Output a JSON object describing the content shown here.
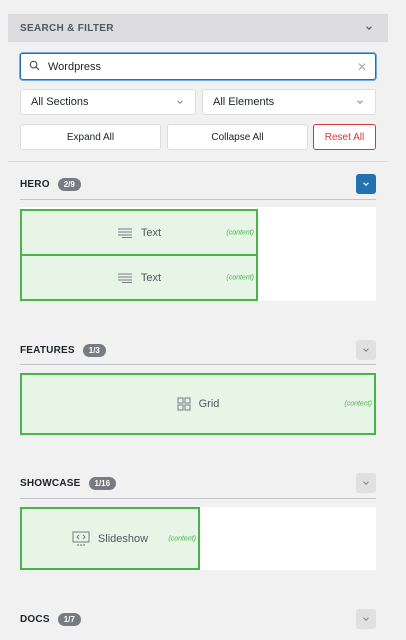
{
  "panel": {
    "title": "SEARCH & FILTER"
  },
  "search": {
    "value": "Wordpress",
    "clear_symbol": "✕"
  },
  "filters": {
    "sections_label": "All Sections",
    "elements_label": "All Elements"
  },
  "buttons": {
    "expand": "Expand All",
    "collapse": "Collapse All",
    "reset": "Reset All"
  },
  "colors": {
    "accent": "#2271b1",
    "match_border": "#4ab34a",
    "match_fill": "#e7f5e6",
    "reset": "#d63638"
  },
  "sections": [
    {
      "title": "HERO",
      "badge": "2/9",
      "expanded": true,
      "elements": [
        {
          "label": "Text",
          "icon": "text-icon",
          "tag": "(content)"
        },
        {
          "label": "Text",
          "icon": "text-icon",
          "tag": "(content)"
        }
      ]
    },
    {
      "title": "FEATURES",
      "badge": "1/3",
      "expanded": false,
      "elements": [
        {
          "label": "Grid",
          "icon": "grid-icon",
          "tag": "(content)"
        }
      ]
    },
    {
      "title": "SHOWCASE",
      "badge": "1/16",
      "expanded": false,
      "elements": [
        {
          "label": "Slideshow",
          "icon": "slideshow-icon",
          "tag": "(content)"
        }
      ]
    },
    {
      "title": "DOCS",
      "badge": "1/7",
      "expanded": false,
      "elements": []
    }
  ]
}
